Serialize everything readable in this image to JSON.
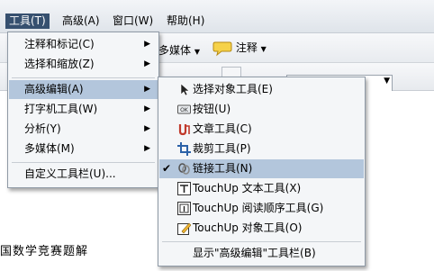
{
  "menubar": {
    "items": [
      {
        "label": "工具(T)"
      },
      {
        "label": "高级(A)"
      },
      {
        "label": "窗口(W)"
      },
      {
        "label": "帮助(H)"
      }
    ]
  },
  "toolbar": {
    "multimedia_label": "多媒体",
    "annotate_label": "注释"
  },
  "document": {
    "text": "国数学竞赛题解"
  },
  "tools_menu": {
    "items": [
      {
        "label": "注释和标记(C)"
      },
      {
        "label": "选择和缩放(Z)"
      },
      {
        "label": "高级编辑(A)"
      },
      {
        "label": "打字机工具(W)"
      },
      {
        "label": "分析(Y)"
      },
      {
        "label": "多媒体(M)"
      },
      {
        "label": "自定义工具栏(U)..."
      }
    ]
  },
  "advanced_editing_menu": {
    "items": [
      {
        "label": "选择对象工具(E)",
        "icon": "arrow-pointer-icon"
      },
      {
        "label": "按钮(U)",
        "icon": "button-ok-icon"
      },
      {
        "label": "文章工具(C)",
        "icon": "article-icon"
      },
      {
        "label": "裁剪工具(P)",
        "icon": "crop-icon"
      },
      {
        "label": "链接工具(N)",
        "icon": "link-chain-icon",
        "checked": true
      },
      {
        "label": "TouchUp 文本工具(X)",
        "icon": "touchup-text-icon"
      },
      {
        "label": "TouchUp 阅读顺序工具(G)",
        "icon": "reading-order-icon"
      },
      {
        "label": "TouchUp 对象工具(O)",
        "icon": "touchup-object-icon"
      },
      {
        "label": "显示\"高级编辑\"工具栏(B)"
      }
    ]
  },
  "colors": {
    "menu_highlight": "#b3c6dc",
    "menubar_active": "#36506f"
  }
}
